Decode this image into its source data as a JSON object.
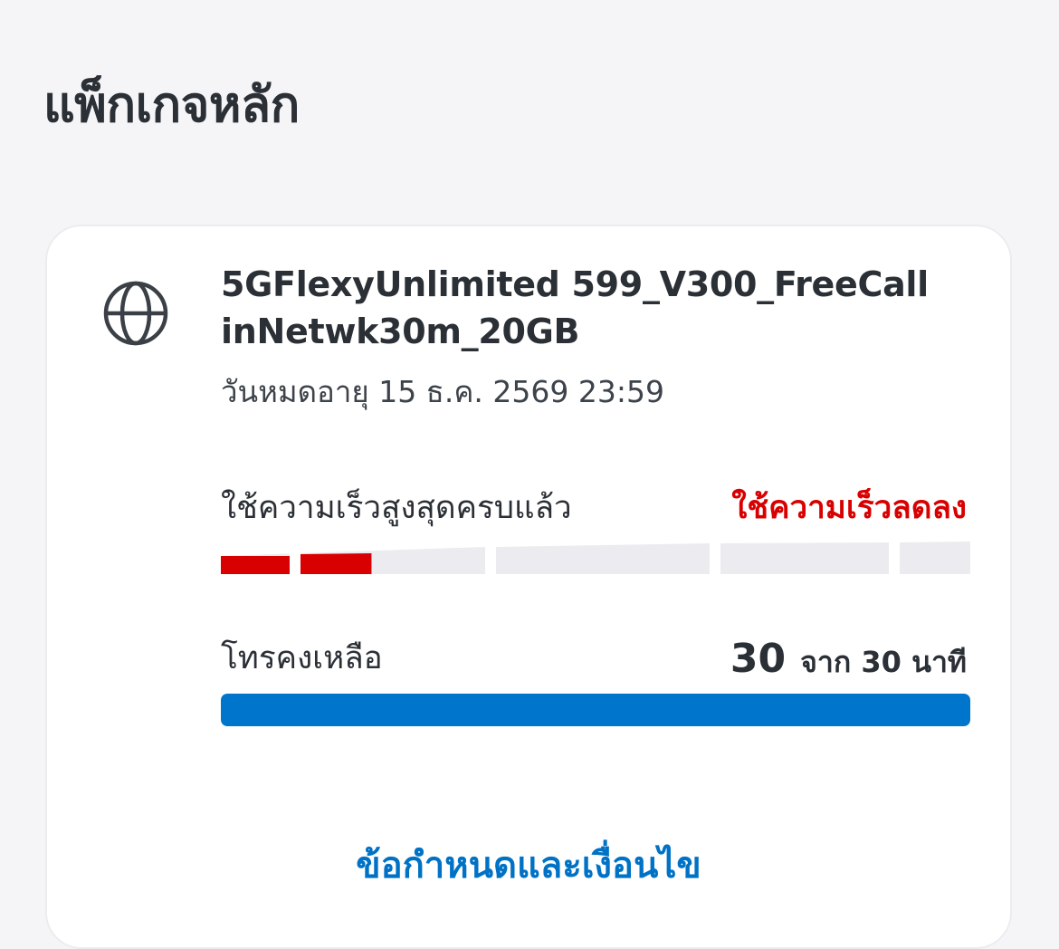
{
  "page": {
    "title": "แพ็กเกจหลัก"
  },
  "package": {
    "icon": "globe-icon",
    "name": "5GFlexyUnlimited 599_V300_FreeCall inNetwk30m_20GB",
    "expiry": "วันหมดอายุ 15 ธ.ค. 2569 23:59"
  },
  "speed_usage": {
    "label": "ใช้ความเร็วสูงสุดครบแล้ว",
    "status": "ใช้ความเร็วลดลง",
    "segments_total": 5,
    "first_segment_fill_fraction": 0.57,
    "used_color": "#d80000",
    "empty_color": "#ececf0"
  },
  "calls": {
    "label": "โทรคงเหลือ",
    "remaining": "30",
    "of_total": "จาก 30 นาที",
    "fill_fraction": 1.0,
    "bar_color": "#0075cc"
  },
  "terms": {
    "label": "ข้อกำหนดและเงื่อนไข"
  },
  "colors": {
    "background": "#f5f5f8",
    "card": "#ffffff",
    "text": "#2b3036",
    "accent_red": "#d80000",
    "accent_blue": "#0072c6"
  }
}
